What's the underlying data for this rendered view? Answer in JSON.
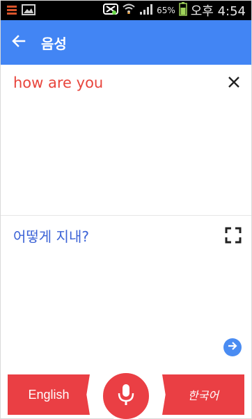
{
  "status_bar": {
    "battery_percent": "65%",
    "time": "오후 4:54",
    "icons": [
      "menu-stack-icon",
      "image-icon",
      "usb-debug-icon",
      "wifi-icon",
      "signal-icon",
      "battery-icon"
    ]
  },
  "app_bar": {
    "title": "음성",
    "back_icon": "arrow-left-icon",
    "background": "#4285f4"
  },
  "source": {
    "text": "how are you",
    "text_color": "#e8453c",
    "clear_icon": "close-icon"
  },
  "translation": {
    "text": "어떻게 지내?",
    "text_color": "#3b62d6",
    "fullscreen_icon": "fullscreen-icon",
    "go_icon": "arrow-right-circle-icon"
  },
  "bottom_bar": {
    "source_language": "English",
    "target_language": "한국어",
    "mic_icon": "microphone-icon",
    "accent": "#ea3f44"
  }
}
